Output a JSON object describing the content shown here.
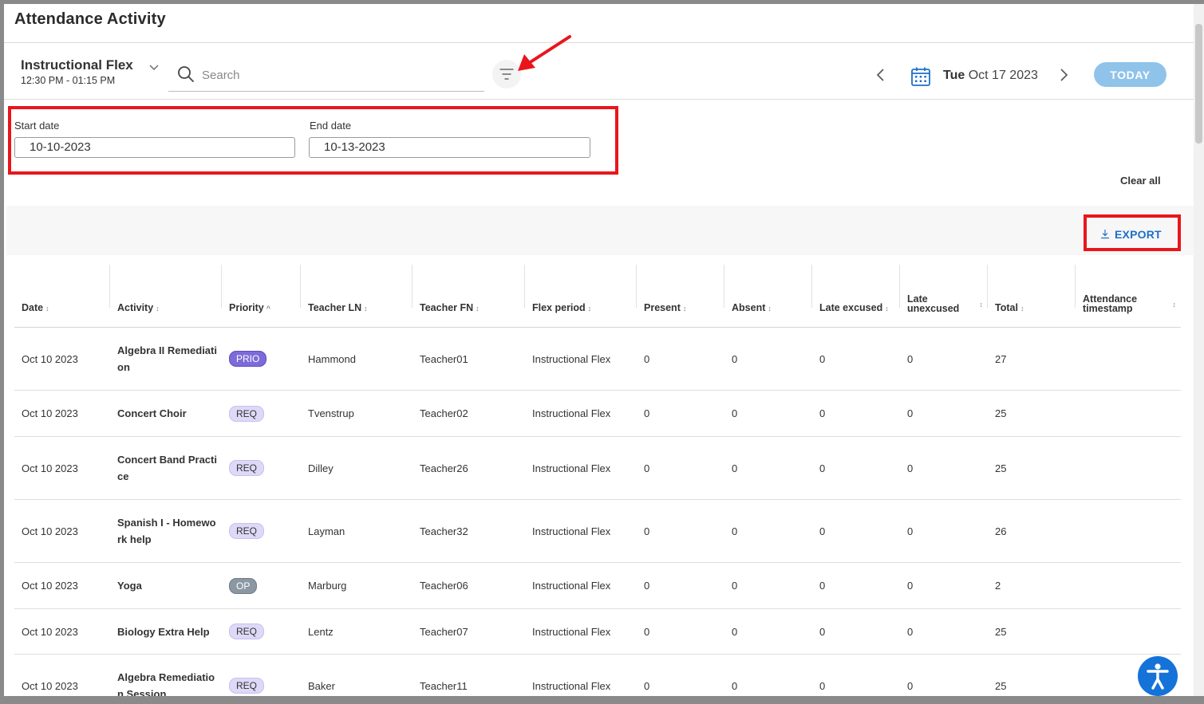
{
  "page": {
    "title": "Attendance Activity"
  },
  "flex": {
    "name": "Instructional Flex",
    "time": "12:30 PM - 01:15 PM"
  },
  "search": {
    "placeholder": "Search",
    "value": ""
  },
  "date_nav": {
    "weekday": "Tue",
    "date": "Oct 17 2023",
    "today_label": "TODAY"
  },
  "filters": {
    "start_label": "Start date",
    "start_value": "10-10-2023",
    "end_label": "End date",
    "end_value": "10-13-2023",
    "clear_all": "Clear all"
  },
  "export": {
    "label": "EXPORT"
  },
  "table": {
    "columns": [
      {
        "line1": "Date",
        "line2": ""
      },
      {
        "line1": "Activity",
        "line2": ""
      },
      {
        "line1": "Priority",
        "line2": ""
      },
      {
        "line1": "Teacher LN",
        "line2": ""
      },
      {
        "line1": "Teacher FN",
        "line2": ""
      },
      {
        "line1": "Flex period",
        "line2": ""
      },
      {
        "line1": "Present",
        "line2": ""
      },
      {
        "line1": "Absent",
        "line2": ""
      },
      {
        "line1": "Late excused",
        "line2": ""
      },
      {
        "line1": "Late",
        "line2": "unexcused"
      },
      {
        "line1": "Total",
        "line2": ""
      },
      {
        "line1": "Attendance",
        "line2": "timestamp"
      }
    ],
    "rows": [
      {
        "date": "Oct 10 2023",
        "activity": "Algebra II Remediation",
        "priority": "PRIO",
        "teacher_ln": "Hammond",
        "teacher_fn": "Teacher01",
        "flex": "Instructional Flex",
        "present": "0",
        "absent": "0",
        "late_excused": "0",
        "late_unexcused": "0",
        "total": "27",
        "timestamp": ""
      },
      {
        "date": "Oct 10 2023",
        "activity": "Concert Choir",
        "priority": "REQ",
        "teacher_ln": "Tvenstrup",
        "teacher_fn": "Teacher02",
        "flex": "Instructional Flex",
        "present": "0",
        "absent": "0",
        "late_excused": "0",
        "late_unexcused": "0",
        "total": "25",
        "timestamp": ""
      },
      {
        "date": "Oct 10 2023",
        "activity": "Concert Band Practice",
        "priority": "REQ",
        "teacher_ln": "Dilley",
        "teacher_fn": "Teacher26",
        "flex": "Instructional Flex",
        "present": "0",
        "absent": "0",
        "late_excused": "0",
        "late_unexcused": "0",
        "total": "25",
        "timestamp": ""
      },
      {
        "date": "Oct 10 2023",
        "activity": "Spanish I - Homework help",
        "priority": "REQ",
        "teacher_ln": "Layman",
        "teacher_fn": "Teacher32",
        "flex": "Instructional Flex",
        "present": "0",
        "absent": "0",
        "late_excused": "0",
        "late_unexcused": "0",
        "total": "26",
        "timestamp": ""
      },
      {
        "date": "Oct 10 2023",
        "activity": "Yoga",
        "priority": "OP",
        "teacher_ln": "Marburg",
        "teacher_fn": "Teacher06",
        "flex": "Instructional Flex",
        "present": "0",
        "absent": "0",
        "late_excused": "0",
        "late_unexcused": "0",
        "total": "2",
        "timestamp": ""
      },
      {
        "date": "Oct 10 2023",
        "activity": "Biology Extra Help",
        "priority": "REQ",
        "teacher_ln": "Lentz",
        "teacher_fn": "Teacher07",
        "flex": "Instructional Flex",
        "present": "0",
        "absent": "0",
        "late_excused": "0",
        "late_unexcused": "0",
        "total": "25",
        "timestamp": ""
      },
      {
        "date": "Oct 10 2023",
        "activity": "Algebra Remediation Session",
        "priority": "REQ",
        "teacher_ln": "Baker",
        "teacher_fn": "Teacher11",
        "flex": "Instructional Flex",
        "present": "0",
        "absent": "0",
        "late_excused": "0",
        "late_unexcused": "0",
        "total": "25",
        "timestamp": ""
      }
    ]
  },
  "colors": {
    "accent": "#1e6fc8",
    "today_button": "#8fc3ea",
    "highlight": "#e8161c",
    "prio_badge": "#7d6bd9",
    "req_badge": "#ddd9f7",
    "op_badge": "#8b98a3"
  },
  "icons": {
    "search": "search-icon",
    "filter": "filter-icon",
    "calendar": "calendar-icon",
    "prev": "chevron-left-icon",
    "next": "chevron-right-icon",
    "export": "download-icon",
    "accessibility": "accessibility-icon"
  }
}
